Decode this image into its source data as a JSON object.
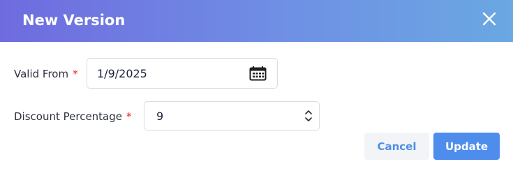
{
  "dialog": {
    "title": "New Version",
    "close_icon": "close-icon"
  },
  "form": {
    "valid_from": {
      "label": "Valid From",
      "required_marker": "*",
      "value": "1/9/2025",
      "icon": "calendar-icon"
    },
    "discount_percentage": {
      "label": "Discount Percentage",
      "required_marker": "*",
      "value": "9",
      "icon": "spinner-arrows-icon"
    }
  },
  "actions": {
    "cancel_label": "Cancel",
    "update_label": "Update"
  },
  "colors": {
    "header_gradient_start": "#6f6bdf",
    "header_gradient_end": "#6aa8e2",
    "required": "#e11d2a",
    "primary_button": "#4f8ded",
    "secondary_button_bg": "#f3f4f7",
    "secondary_button_text": "#4d8ee4"
  }
}
